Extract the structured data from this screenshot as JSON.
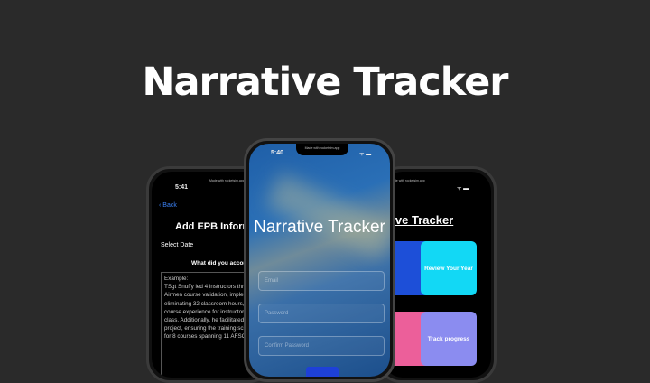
{
  "title": "Narrative Tracker",
  "left_phone": {
    "time": "5:41",
    "made_with": "Made with rocketsim.app",
    "back_label": "Back",
    "screen_title": "Add EPB Information",
    "select_date_label": "Select Date",
    "question": "What did you accomplish?",
    "example_text": "Example:\nTSgt Snuffy led 4 instructors through the Ready Airmen course validation, implementing 153 changes, eliminating 32 classroom hours, and enhancing course experience for instructors and 70 students per class. Additionally, he facilitated a $1M renovation project, ensuring the training schedule started on-time for 8 courses spanning 11 AFSCs."
  },
  "center_phone": {
    "time": "5:40",
    "made_with": "Made with rocketsim.app",
    "app_name": "Narrative Tracker",
    "email_placeholder": "Email",
    "password_placeholder": "Password",
    "confirm_placeholder": "Confirm Password"
  },
  "right_phone": {
    "made_with": "Made with rocketsim.app",
    "screen_title": "Narrative Tracker",
    "tiles": [
      {
        "label": "",
        "color": "#1d4fd8"
      },
      {
        "label": "Review Your Year",
        "color": "#12d8f5"
      },
      {
        "label": "",
        "color": "#ec5f9a"
      },
      {
        "label": "Track progress",
        "color": "#8b8cf0"
      }
    ]
  }
}
